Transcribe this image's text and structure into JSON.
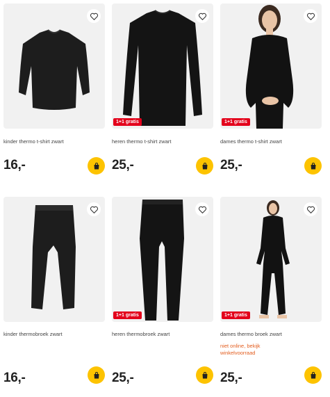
{
  "products": [
    {
      "name": "kinder thermo t-shirt zwart",
      "price": "16,-",
      "badge": "",
      "availability": "",
      "icons": [
        "heart-icon",
        "shopping-bag-icon"
      ]
    },
    {
      "name": "heren thermo t-shirt zwart",
      "price": "25,-",
      "badge": "1+1 gratis",
      "availability": "",
      "icons": [
        "heart-icon",
        "shopping-bag-icon"
      ]
    },
    {
      "name": "dames thermo t-shirt zwart",
      "price": "25,-",
      "badge": "1+1 gratis",
      "availability": "",
      "icons": [
        "heart-icon",
        "shopping-bag-icon"
      ]
    },
    {
      "name": "kinder thermobroek zwart",
      "price": "16,-",
      "badge": "",
      "availability": "",
      "icons": [
        "heart-icon",
        "shopping-bag-icon"
      ]
    },
    {
      "name": "heren thermobroek zwart",
      "price": "25,-",
      "badge": "1+1 gratis",
      "availability": "",
      "icons": [
        "heart-icon",
        "shopping-bag-icon"
      ]
    },
    {
      "name": "dames thermo broek zwart",
      "price": "25,-",
      "badge": "1+1 gratis",
      "availability": "niet online, bekijk winkelvoorraad",
      "icons": [
        "heart-icon",
        "shopping-bag-icon"
      ]
    }
  ],
  "colors": {
    "badge": "#e3001b",
    "cart_button": "#fdc300",
    "availability": "#e35d1e",
    "image_bg": "#f1f1f1"
  }
}
